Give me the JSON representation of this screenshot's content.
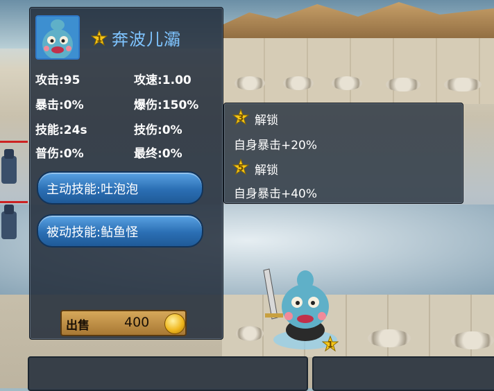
{
  "hero": {
    "level": "1",
    "name": "奔波儿灞"
  },
  "stats": {
    "attack": "攻击:95",
    "attack_speed": "攻速:1.00",
    "crit": "暴击:0%",
    "crit_damage": "爆伤:150%",
    "skill_cd": "技能:24s",
    "skill_damage": "技伤:0%",
    "normal_damage": "普伤:0%",
    "final_damage": "最终:0%"
  },
  "skills": {
    "active": "主动技能:吐泡泡",
    "passive": "被动技能:鲇鱼怪"
  },
  "sell": {
    "label": "出售",
    "price": "400"
  },
  "unlocks": [
    {
      "stars": "3",
      "title": "解锁",
      "desc": "自身暴击+20%"
    },
    {
      "stars": "5",
      "title": "解锁",
      "desc": "自身暴击+40%"
    }
  ],
  "unit_level": "1",
  "colors": {
    "panel_bg": "#222c3a",
    "name_color": "#7fc4ff",
    "button_blue": "#2b6fb4",
    "gold": "#f0b820",
    "star": "#f5c518"
  },
  "icons": {
    "star": "star-icon",
    "coin": "gold-coin-icon",
    "portrait": "fish-monster-portrait"
  }
}
